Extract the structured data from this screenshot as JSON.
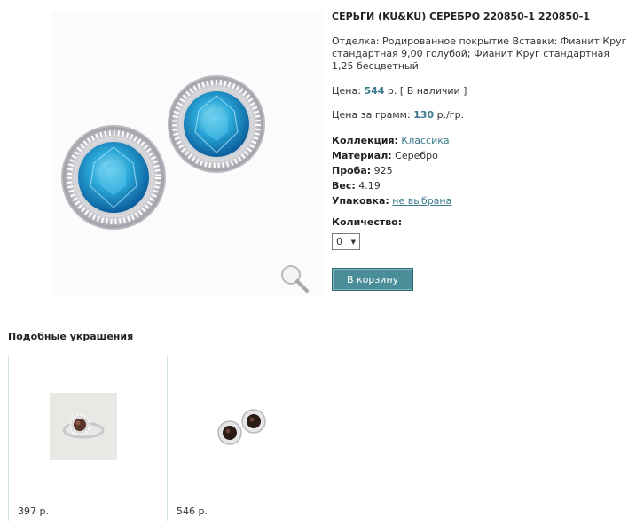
{
  "product": {
    "title": "СЕРЬГИ (KU&KU) СЕРЕБРО 220850-1 220850-1",
    "description": "Отделка: Родированное покрытие Вставки: Фианит Круг стандартная 9,00 голубой; Фианит Круг стандартная 1,25 бесцветный",
    "price_label": "Цена:",
    "price_value": "544",
    "price_currency": "р.",
    "availability": "[ В наличии ]",
    "per_gram_label": "Цена за грамм:",
    "per_gram_value": "130",
    "per_gram_unit": "р./гр.",
    "collection_label": "Коллекция:",
    "collection_value": "Классика",
    "material_label": "Материал:",
    "material_value": "Серебро",
    "probe_label": "Проба:",
    "probe_value": "925",
    "weight_label": "Вес:",
    "weight_value": "4.19",
    "package_label": "Упаковка:",
    "package_value": "не выбрана",
    "quantity_label": "Количество:",
    "quantity_value": "0",
    "cart_button": "В корзину"
  },
  "similar": {
    "heading": "Подобные украшения",
    "items": [
      {
        "price": "397 р."
      },
      {
        "price": "546 р."
      }
    ]
  },
  "colors": {
    "accent": "#3a7a8c",
    "button": "#4a8e99",
    "stone": "#2aa8d8",
    "dark_stone": "#5a3428"
  }
}
